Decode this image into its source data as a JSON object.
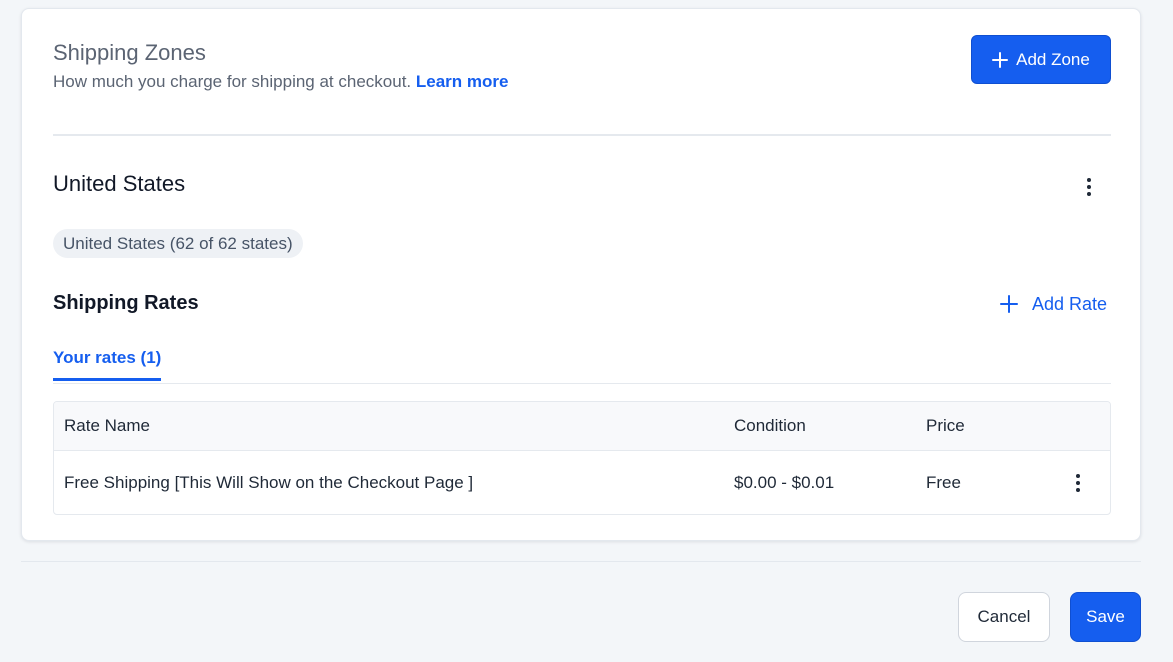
{
  "header": {
    "title": "Shipping Zones",
    "subtitle": "How much you charge for shipping at checkout.",
    "learn_more": "Learn more",
    "add_zone_label": "Add Zone"
  },
  "zone": {
    "name": "United States",
    "chip": "United States (62 of 62 states)"
  },
  "rates": {
    "title": "Shipping Rates",
    "add_rate_label": "Add Rate",
    "tab_label": "Your rates (1)",
    "columns": [
      "Rate Name",
      "Condition",
      "Price"
    ],
    "rows": [
      {
        "name": "Free Shipping [This Will Show on the Checkout Page ]",
        "condition": "$0.00 - $0.01",
        "price": "Free"
      }
    ]
  },
  "footer": {
    "cancel_label": "Cancel",
    "save_label": "Save"
  },
  "colors": {
    "accent": "#155eef",
    "background": "#f3f6f9"
  },
  "icons": [
    "plus-icon",
    "kebab-menu-icon"
  ]
}
